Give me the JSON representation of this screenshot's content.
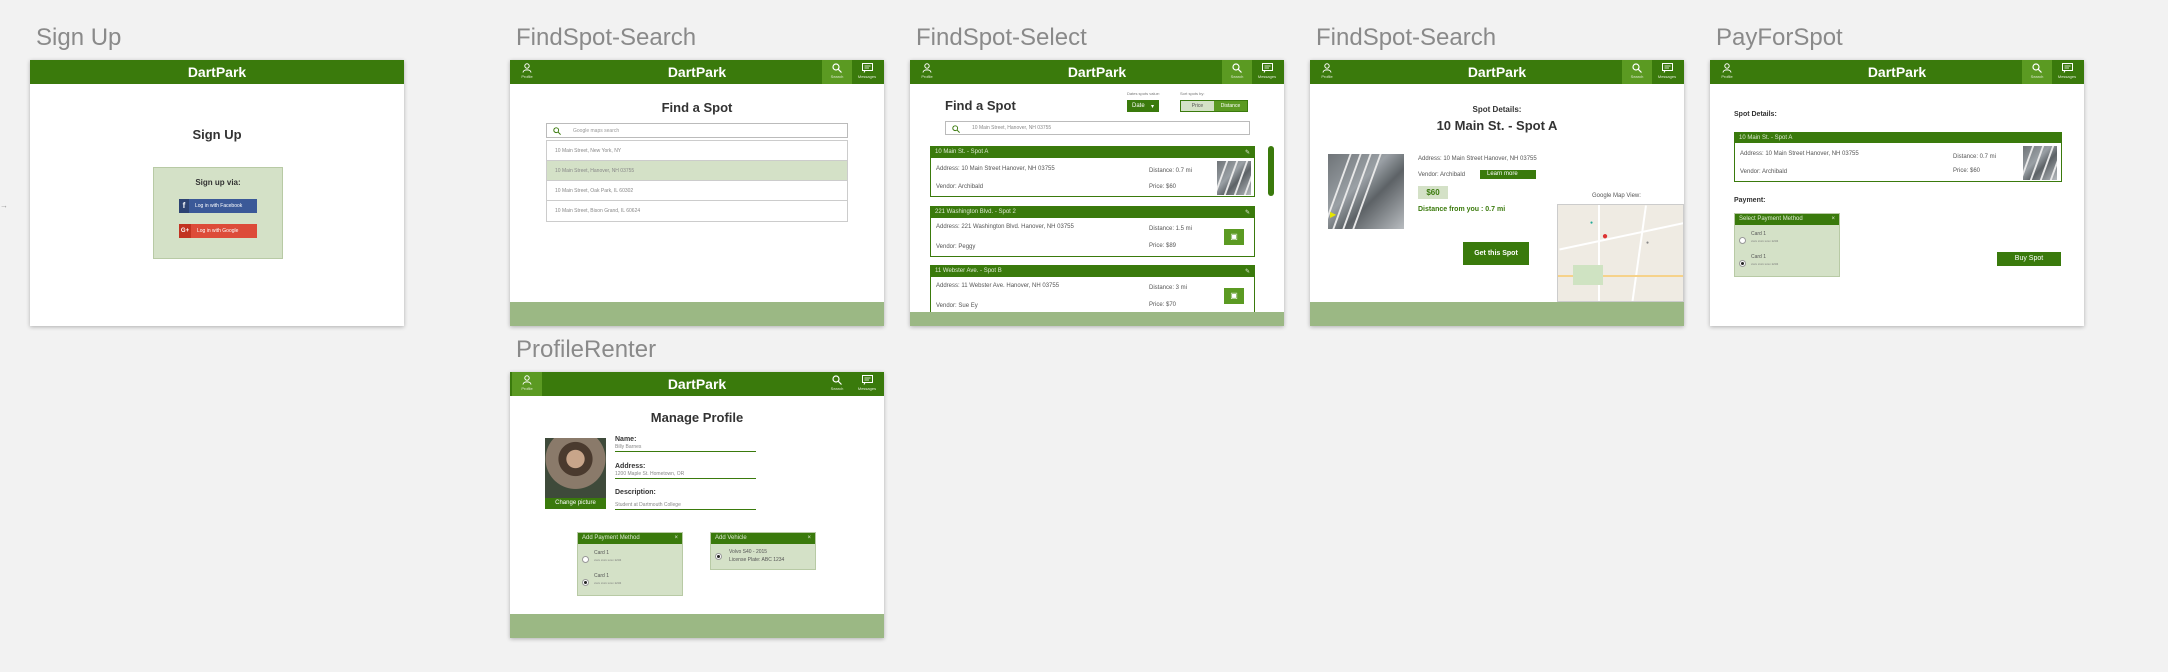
{
  "app_name": "DartPark",
  "colors": {
    "header_green": "#3a7a0c",
    "active_nav": "#5b9a22",
    "footer_green": "#9bb884",
    "panel_green": "#d4e1c7",
    "facebook": "#3b5998",
    "google": "#dd4b39"
  },
  "nav": {
    "profile": "Profile",
    "search": "Search",
    "messages": "Messages"
  },
  "signup": {
    "artboard_title": "Sign Up",
    "heading": "Sign Up",
    "panel_title": "Sign up via:",
    "facebook_label": "Log in with Facebook",
    "google_label": "Log in with Google"
  },
  "search": {
    "artboard_title": "FindSpot-Search",
    "heading": "Find a Spot",
    "placeholder": "Google maps search",
    "results": [
      "10 Main Street, New York, NY",
      "10 Main Street, Hanover, NH 03755",
      "10 Main Street, Oak Park, IL 60302",
      "10 Main Street, Bison Grand, IL 60624"
    ]
  },
  "select": {
    "artboard_title": "FindSpot-Select",
    "heading": "Find a Spot",
    "date_label": "Dates spots value:",
    "date_value": "Date",
    "sort_label": "Sort spots by:",
    "sort_price": "Price",
    "sort_distance": "Distance",
    "search_value": "10 Main Street, Hanover, NH 03755",
    "listings": [
      {
        "title": "10 Main St. - Spot A",
        "address": "Address: 10 Main Street Hanover, NH 03755",
        "vendor": "Vendor: Archibald",
        "distance": "Distance: 0.7 mi",
        "price": "Price: $60"
      },
      {
        "title": "221 Washington Blvd. - Spot 2",
        "address": "Address: 221 Washington Blvd. Hanover, NH 03755",
        "vendor": "Vendor: Peggy",
        "distance": "Distance: 1.5 mi",
        "price": "Price: $89"
      },
      {
        "title": "11 Webster Ave. - Spot B",
        "address": "Address: 11 Webster Ave. Hanover, NH 03755",
        "vendor": "Vendor: Sue Ey",
        "distance": "Distance: 3 mi",
        "price": "Price: $70"
      }
    ]
  },
  "details": {
    "artboard_title": "FindSpot-Search",
    "label": "Spot Details:",
    "title": "10 Main St. - Spot A",
    "address": "Address: 10 Main Street Hanover, NH 03755",
    "vendor": "Vendor: Archibald",
    "learn_more": "Learn more",
    "price": "$60",
    "distance": "Distance from you : 0.7 mi",
    "button": "Get this Spot",
    "map_label": "Google Map View:"
  },
  "pay": {
    "artboard_title": "PayForSpot",
    "label": "Spot Details:",
    "card_title": "10 Main St. - Spot A",
    "address": "Address: 10 Main Street Hanover, NH 03755",
    "vendor": "Vendor: Archibald",
    "distance": "Distance: 0.7 mi",
    "price": "Price: $60",
    "payment_label": "Payment:",
    "payment_header": "Select Payment Method",
    "cards": [
      {
        "name": "Card 1",
        "sub": "xxxx xxxx xxxx 1234"
      },
      {
        "name": "Card 1",
        "sub": "xxxx xxxx xxxx 1234"
      }
    ],
    "button": "Buy Spot"
  },
  "profile": {
    "artboard_title": "ProfileRenter",
    "heading": "Manage Profile",
    "change_picture": "Change picture",
    "name_label": "Name:",
    "name_value": "Billy Barnes",
    "address_label": "Address:",
    "address_value": "1200 Maple St. Hometown, OR",
    "description_label": "Description:",
    "description_value": "Student at Dartmouth College",
    "payment_header": "Add Payment Method",
    "cards": [
      {
        "name": "Card 1",
        "sub": "xxxx xxxx xxxx 1234"
      },
      {
        "name": "Card 1",
        "sub": "xxxx xxxx xxxx 1234"
      }
    ],
    "vehicle_header": "Add Vehicle",
    "vehicle_line1": "Volvo S40 - 2015",
    "vehicle_line2": "License Plate: ABC 1234"
  }
}
